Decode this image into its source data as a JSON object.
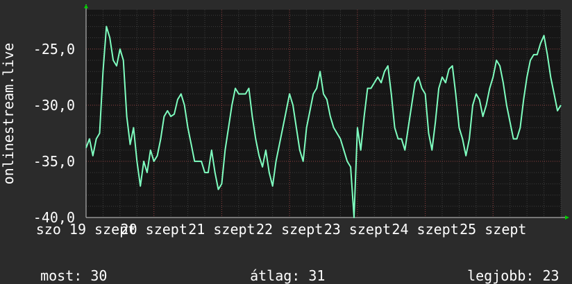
{
  "colors": {
    "background": "#2b2b2b",
    "plot_background": "#161616",
    "grid": "#5a5a5a",
    "line": "#7fffc0",
    "axis_arrow": "#00cc00",
    "text": "#ffffff"
  },
  "chart_data": {
    "type": "line",
    "ylabel": "onlinestream.live",
    "ylim": [
      -40.0,
      -21.5
    ],
    "yticks": [
      -25.0,
      -30.0,
      -35.0,
      -40.0
    ],
    "ytick_labels": [
      "-25,0",
      "-30,0",
      "-35,0",
      "-40,0"
    ],
    "xlim": [
      0,
      7
    ],
    "xtick_labels": [
      "szo 19 szept",
      "20 szept",
      "21 szept",
      "22 szept",
      "23 szept",
      "24 szept",
      "25 szept"
    ],
    "grid": true,
    "series": [
      {
        "x": [
          0,
          0.05,
          0.1,
          0.15,
          0.2,
          0.25,
          0.3,
          0.35,
          0.4,
          0.45,
          0.5,
          0.55,
          0.6,
          0.65,
          0.7,
          0.75,
          0.8,
          0.85,
          0.9,
          0.95,
          1.0,
          1.05,
          1.1,
          1.15,
          1.2,
          1.25,
          1.3,
          1.35,
          1.4,
          1.45,
          1.5,
          1.55,
          1.6,
          1.65,
          1.7,
          1.75,
          1.8,
          1.85,
          1.9,
          1.95,
          2.0,
          2.05,
          2.1,
          2.15,
          2.2,
          2.25,
          2.3,
          2.35,
          2.4,
          2.45,
          2.5,
          2.55,
          2.6,
          2.65,
          2.7,
          2.75,
          2.8,
          2.85,
          2.9,
          2.95,
          3.0,
          3.05,
          3.1,
          3.15,
          3.2,
          3.25,
          3.3,
          3.35,
          3.4,
          3.45,
          3.5,
          3.55,
          3.6,
          3.65,
          3.7,
          3.75,
          3.8,
          3.85,
          3.9,
          3.95,
          4.0,
          4.05,
          4.1,
          4.15,
          4.2,
          4.25,
          4.3,
          4.35,
          4.4,
          4.45,
          4.5,
          4.55,
          4.6,
          4.65,
          4.7,
          4.75,
          4.8,
          4.85,
          4.9,
          4.95,
          5.0,
          5.05,
          5.1,
          5.15,
          5.2,
          5.25,
          5.3,
          5.35,
          5.4,
          5.45,
          5.5,
          5.55,
          5.6,
          5.65,
          5.7,
          5.75,
          5.8,
          5.85,
          5.9,
          5.95,
          6.0,
          6.05,
          6.1,
          6.15,
          6.2,
          6.25,
          6.3,
          6.35,
          6.4,
          6.45,
          6.5,
          6.55,
          6.6,
          6.65,
          6.7,
          6.75,
          6.8,
          6.85,
          6.9,
          6.95,
          7.0
        ],
        "values": [
          -33.8,
          -33.0,
          -34.5,
          -33.0,
          -32.5,
          -27.0,
          -23.0,
          -24.0,
          -26.0,
          -26.5,
          -25.0,
          -26.0,
          -31.0,
          -33.5,
          -32.0,
          -35.0,
          -37.2,
          -35.0,
          -36.0,
          -34.0,
          -35.0,
          -34.5,
          -33.0,
          -31.0,
          -30.5,
          -31.0,
          -30.8,
          -29.5,
          -29.0,
          -30.0,
          -32.0,
          -33.5,
          -35.0,
          -35.0,
          -35.0,
          -36.0,
          -36.0,
          -34.0,
          -36.0,
          -37.5,
          -37.0,
          -34.0,
          -32.0,
          -30.0,
          -28.5,
          -29.0,
          -29.0,
          -29.0,
          -28.5,
          -31.0,
          -33.0,
          -34.5,
          -35.5,
          -34.0,
          -36.0,
          -37.2,
          -35.0,
          -33.5,
          -32.0,
          -30.5,
          -29.0,
          -30.0,
          -32.0,
          -34.0,
          -35.0,
          -32.0,
          -30.5,
          -29.0,
          -28.5,
          -27.0,
          -29.0,
          -29.5,
          -31.0,
          -32.0,
          -32.5,
          -33.0,
          -34.0,
          -35.0,
          -35.5,
          -40.0,
          -32.0,
          -34.0,
          -31.0,
          -28.5,
          -28.5,
          -28.0,
          -27.5,
          -28.0,
          -27.0,
          -26.5,
          -29.0,
          -32.0,
          -33.0,
          -33.0,
          -34.0,
          -32.0,
          -30.0,
          -28.0,
          -27.5,
          -28.5,
          -29.0,
          -32.5,
          -34.0,
          -31.5,
          -28.5,
          -27.5,
          -28.0,
          -26.8,
          -26.5,
          -29.0,
          -32.0,
          -33.0,
          -34.5,
          -33.0,
          -30.0,
          -29.0,
          -29.5,
          -31.0,
          -30.0,
          -28.5,
          -27.5,
          -26.0,
          -26.5,
          -28.0,
          -30.0,
          -31.5,
          -33.0,
          -33.0,
          -32.0,
          -29.5,
          -27.5,
          -26.0,
          -25.5,
          -25.5,
          -24.5,
          -23.8,
          -25.5,
          -27.5,
          -29.0,
          -30.5,
          -30.0
        ]
      }
    ]
  },
  "stats": {
    "current_label": "most:",
    "current_value": "30",
    "average_label": "átlag:",
    "average_value": "31",
    "best_label": "legjobb:",
    "best_value": "23"
  }
}
